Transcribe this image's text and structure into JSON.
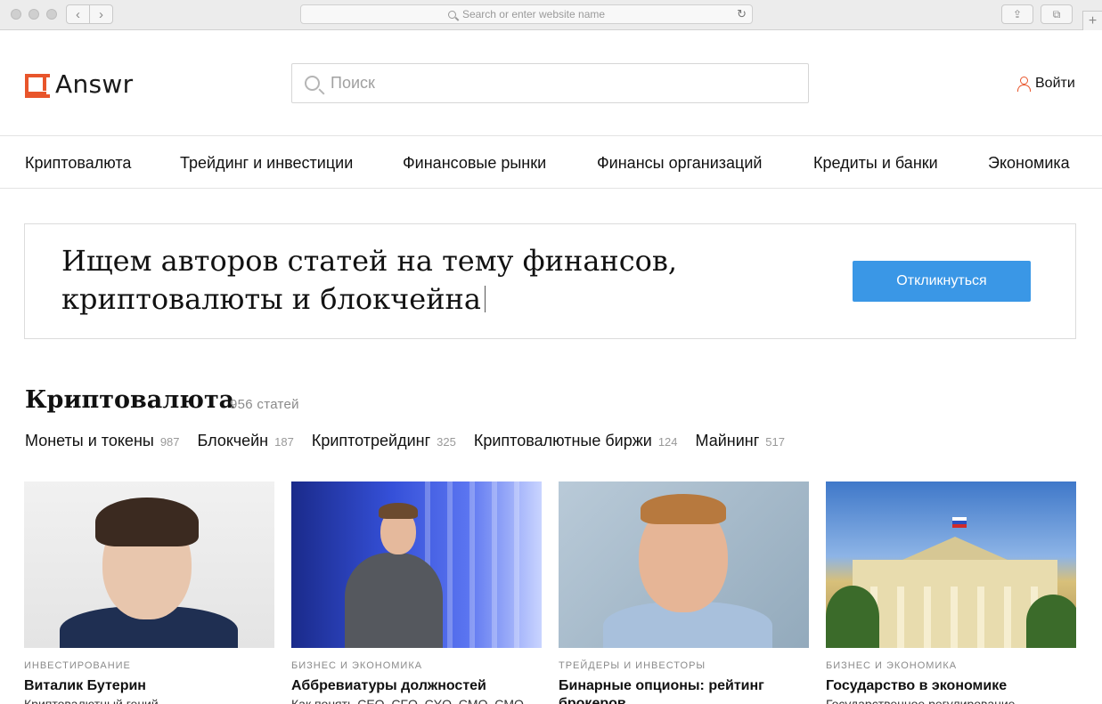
{
  "browser": {
    "address_placeholder": "Search or enter website name",
    "back_icon": "chevron-left-icon",
    "forward_icon": "chevron-right-icon"
  },
  "header": {
    "logo_text": "Answr",
    "search_placeholder": "Поиск",
    "login_label": "Войти"
  },
  "nav": {
    "items": [
      "Криптовалюта",
      "Трейдинг и инвестиции",
      "Финансовые рынки",
      "Финансы организаций",
      "Кредиты и банки",
      "Экономика"
    ]
  },
  "banner": {
    "line1": "Ищем авторов статей на тему финансов,",
    "line2": "криптовалюты и блокчейна",
    "button_label": "Откликнуться"
  },
  "section": {
    "title": "Криптовалюта",
    "count": "956 статей",
    "subcategories": [
      {
        "label": "Монеты и токены",
        "count": "987"
      },
      {
        "label": "Блокчейн",
        "count": "187"
      },
      {
        "label": "Криптотрейдинг",
        "count": "325"
      },
      {
        "label": "Криптовалютные биржи",
        "count": "124"
      },
      {
        "label": "Майнинг",
        "count": "517"
      }
    ]
  },
  "cards": [
    {
      "tag": "ИНВЕСТИРОВАНИЕ",
      "title": "Виталик Бутерин",
      "subtitle": "Криптовалютный гений"
    },
    {
      "tag": "БИЗНЕС И ЭКОНОМИКА",
      "title": "Аббревиатуры должностей",
      "subtitle": "Как понять CEO, CFO, CYO, CMO, CMO"
    },
    {
      "tag": "ТРЕЙДЕРЫ И ИНВЕСТОРЫ",
      "title": "Бинарные опционы: рейтинг брокеров",
      "subtitle": ""
    },
    {
      "tag": "БИЗНЕС И ЭКОНОМИКА",
      "title": "Государство в экономике",
      "subtitle": "Государственное регулирование"
    }
  ],
  "colors": {
    "accent": "#e8552b",
    "button": "#3a97e6"
  }
}
